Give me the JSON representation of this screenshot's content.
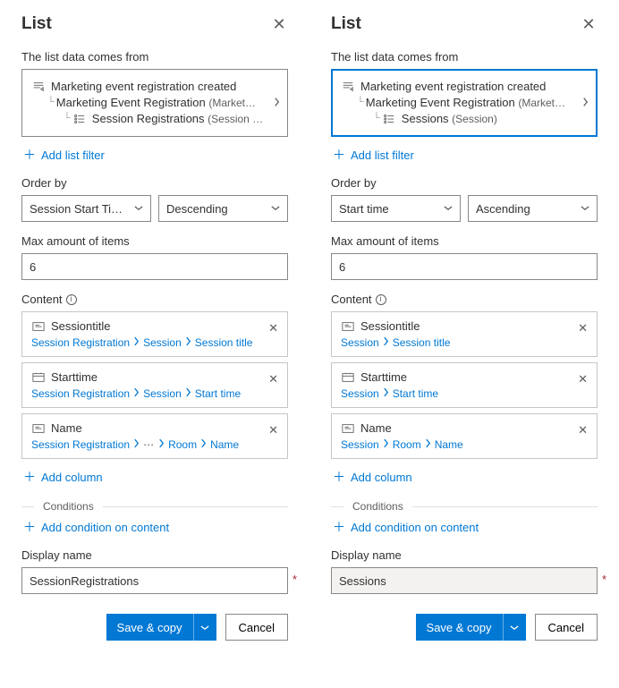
{
  "panels": [
    {
      "title": "List",
      "dataSourceLabel": "The list data comes from",
      "selected": false,
      "trigger": "Marketing event registration created",
      "level1": "Marketing Event Registration",
      "level1sub": "(Market…",
      "level2": "Session Registrations",
      "level2sub": "(Session …",
      "level2icon": "list",
      "addFilter": "Add list filter",
      "orderByLabel": "Order by",
      "orderByField": "Session Start Ti…",
      "orderByDir": "Descending",
      "maxLabel": "Max amount of items",
      "maxValue": "6",
      "contentLabel": "Content",
      "cards": [
        {
          "icon": "text",
          "title": "Sessiontitle",
          "crumbs": [
            "Session Registration",
            "Session",
            "Session title"
          ]
        },
        {
          "icon": "date",
          "title": "Starttime",
          "crumbs": [
            "Session Registration",
            "Session",
            "Start time"
          ]
        },
        {
          "icon": "text",
          "title": "Name",
          "crumbs": [
            "Session Registration",
            "…",
            "Room",
            "Name"
          ]
        }
      ],
      "addColumn": "Add column",
      "conditions": "Conditions",
      "addCondition": "Add condition on content",
      "displayNameLabel": "Display name",
      "displayName": "SessionRegistrations",
      "displayReadonly": false,
      "saveCopy": "Save & copy",
      "cancel": "Cancel"
    },
    {
      "title": "List",
      "dataSourceLabel": "The list data comes from",
      "selected": true,
      "trigger": "Marketing event registration created",
      "level1": "Marketing Event Registration",
      "level1sub": "(Market…",
      "level2": "Sessions",
      "level2sub": "(Session)",
      "level2icon": "list",
      "addFilter": "Add list filter",
      "orderByLabel": "Order by",
      "orderByField": "Start time",
      "orderByDir": "Ascending",
      "maxLabel": "Max amount of items",
      "maxValue": "6",
      "contentLabel": "Content",
      "cards": [
        {
          "icon": "text",
          "title": "Sessiontitle",
          "crumbs": [
            "Session",
            "Session title"
          ]
        },
        {
          "icon": "date",
          "title": "Starttime",
          "crumbs": [
            "Session",
            "Start time"
          ]
        },
        {
          "icon": "text",
          "title": "Name",
          "crumbs": [
            "Session",
            "Room",
            "Name"
          ]
        }
      ],
      "addColumn": "Add column",
      "conditions": "Conditions",
      "addCondition": "Add condition on content",
      "displayNameLabel": "Display name",
      "displayName": "Sessions",
      "displayReadonly": true,
      "saveCopy": "Save & copy",
      "cancel": "Cancel"
    }
  ]
}
